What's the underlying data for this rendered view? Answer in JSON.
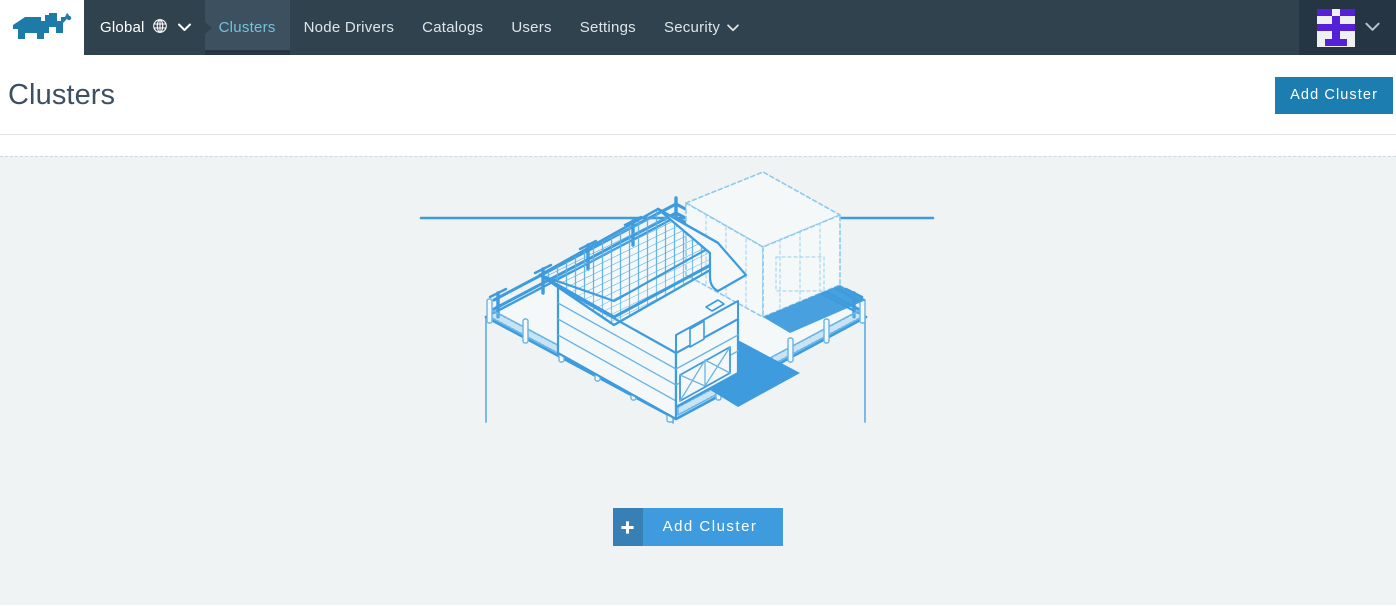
{
  "brand": {
    "logo_icon": "rancher-cow-logo",
    "logo_color": "#1d7ba8"
  },
  "navbar": {
    "background": "#31424f",
    "cluster_picker": {
      "label": "Global",
      "globe_icon": "globe-icon",
      "chevron_icon": "chevron-down-icon"
    },
    "items": [
      {
        "label": "Clusters",
        "active": true
      },
      {
        "label": "Node Drivers",
        "active": false
      },
      {
        "label": "Catalogs",
        "active": false
      },
      {
        "label": "Users",
        "active": false
      },
      {
        "label": "Settings",
        "active": false
      },
      {
        "label": "Security",
        "active": false,
        "chevron_icon": "chevron-down-icon"
      }
    ],
    "active_color": "#73c3da",
    "user_menu": {
      "avatar_icon": "user-identicon-avatar",
      "chevron_icon": "chevron-down-icon",
      "avatar_colors": {
        "fg": "#5521d6",
        "bg": "#eef0f1"
      },
      "avatar_grid": [
        [
          1,
          1,
          0,
          1,
          1
        ],
        [
          0,
          0,
          1,
          0,
          0
        ],
        [
          1,
          1,
          1,
          1,
          1
        ],
        [
          0,
          0,
          1,
          0,
          0
        ],
        [
          0,
          1,
          1,
          1,
          0
        ]
      ]
    }
  },
  "page": {
    "title": "Clusters",
    "add_cluster_label": "Add Cluster",
    "primary_color": "#1c7db0"
  },
  "empty_state": {
    "illustration": "isometric-farm-barn-fence-illustration",
    "illustration_color": "#3e9bdd",
    "background": "#eff3f4",
    "cta": {
      "label": "Add Cluster",
      "plus_icon": "plus-icon",
      "color": "#3e9bdd",
      "plus_color": "#3680b5"
    }
  }
}
